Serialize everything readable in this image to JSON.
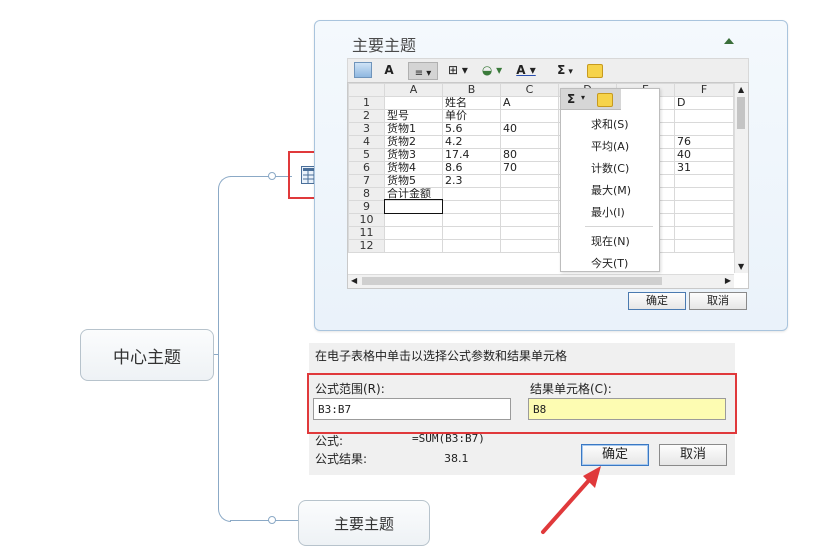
{
  "mindmap": {
    "center_topic": "中心主题",
    "sub_topic": "主要主题"
  },
  "panel": {
    "title": "主要主题",
    "toolbar": {
      "sum_symbol": "Σ",
      "font_a": "A"
    },
    "sheet": {
      "col_headers": [
        "A",
        "B",
        "C",
        "D",
        "E",
        "F"
      ],
      "rows": [
        {
          "n": "1",
          "cells": [
            "",
            "姓名",
            "A",
            "",
            "",
            "D"
          ]
        },
        {
          "n": "2",
          "cells": [
            "型号",
            "单价",
            "",
            "",
            "",
            ""
          ]
        },
        {
          "n": "3",
          "cells": [
            "货物1",
            "5.6",
            "40",
            "",
            "",
            ""
          ]
        },
        {
          "n": "4",
          "cells": [
            "货物2",
            "4.2",
            "",
            "",
            "",
            "76"
          ]
        },
        {
          "n": "5",
          "cells": [
            "货物3",
            "17.4",
            "80",
            "",
            "",
            "40"
          ]
        },
        {
          "n": "6",
          "cells": [
            "货物4",
            "8.6",
            "70",
            "",
            "",
            "31"
          ]
        },
        {
          "n": "7",
          "cells": [
            "货物5",
            "2.3",
            "",
            "",
            "",
            ""
          ]
        },
        {
          "n": "8",
          "cells": [
            "合计金额",
            "",
            "",
            "",
            "",
            ""
          ]
        },
        {
          "n": "9",
          "cells": [
            "",
            "",
            "",
            "",
            "",
            ""
          ]
        },
        {
          "n": "10",
          "cells": [
            "",
            "",
            "",
            "",
            "",
            ""
          ]
        },
        {
          "n": "11",
          "cells": [
            "",
            "",
            "",
            "",
            "",
            ""
          ]
        },
        {
          "n": "12",
          "cells": [
            "",
            "",
            "",
            "",
            "",
            ""
          ]
        }
      ]
    },
    "menu": {
      "items": [
        "求和(S)",
        "平均(A)",
        "计数(C)",
        "最大(M)",
        "最小(I)",
        "现在(N)",
        "今天(T)"
      ]
    },
    "ok_label": "确定",
    "cancel_label": "取消"
  },
  "dialog": {
    "instruction": "在电子表格中单击以选择公式参数和结果单元格",
    "range_label": "公式范围(R):",
    "range_value": "B3:B7",
    "result_label": "结果单元格(C):",
    "result_value": "B8",
    "formula_label": "公式:",
    "formula_value": "=SUM(B3:B7)",
    "result_text_label": "公式结果:",
    "result_text_value": "38.1",
    "ok_label": "确定",
    "cancel_label": "取消"
  },
  "colors": {
    "highlight_red": "#e0393b",
    "result_field_yellow": "#fdfcb2",
    "connector_blue": "#8ba9c6"
  }
}
